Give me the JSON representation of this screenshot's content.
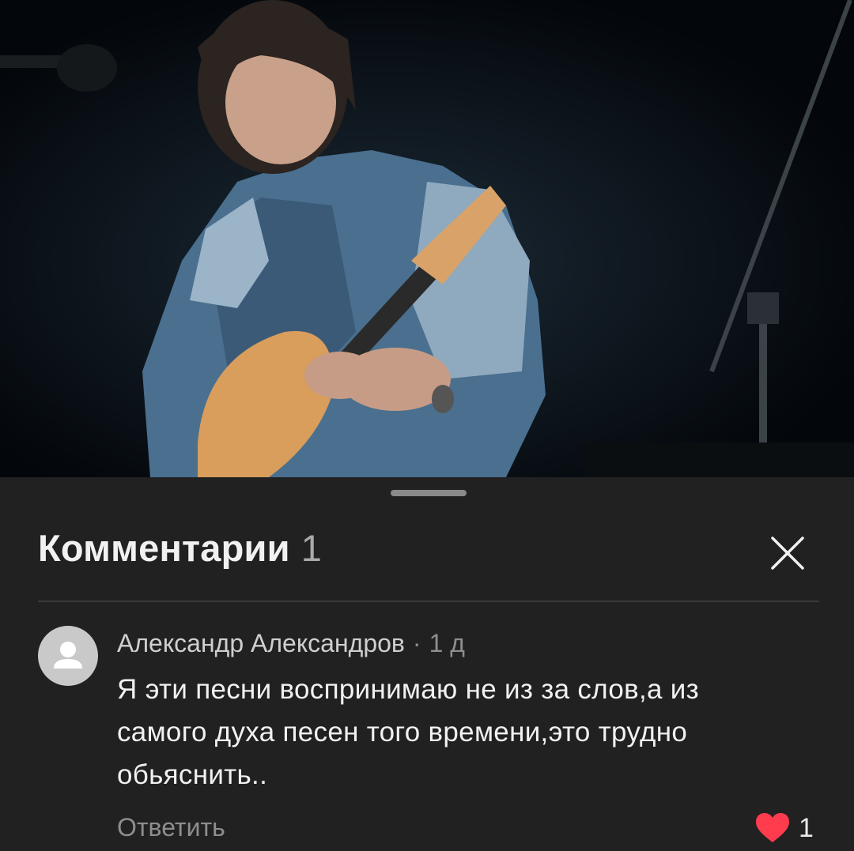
{
  "video": {
    "description_icon": "guitarist-video-frame"
  },
  "comments_panel": {
    "title": "Комментарии",
    "count": "1",
    "close_icon": "close-icon"
  },
  "comment": {
    "author": "Александр Александров",
    "separator": "·",
    "time": "1 д",
    "text_lines": [
      "Я эти песни воспринимаю не из за слов,а из",
      "самого духа песен того времени,это трудно",
      "обьяснить.."
    ],
    "reply_label": "Ответить",
    "likes": "1",
    "like_color": "#ff3b4e"
  }
}
